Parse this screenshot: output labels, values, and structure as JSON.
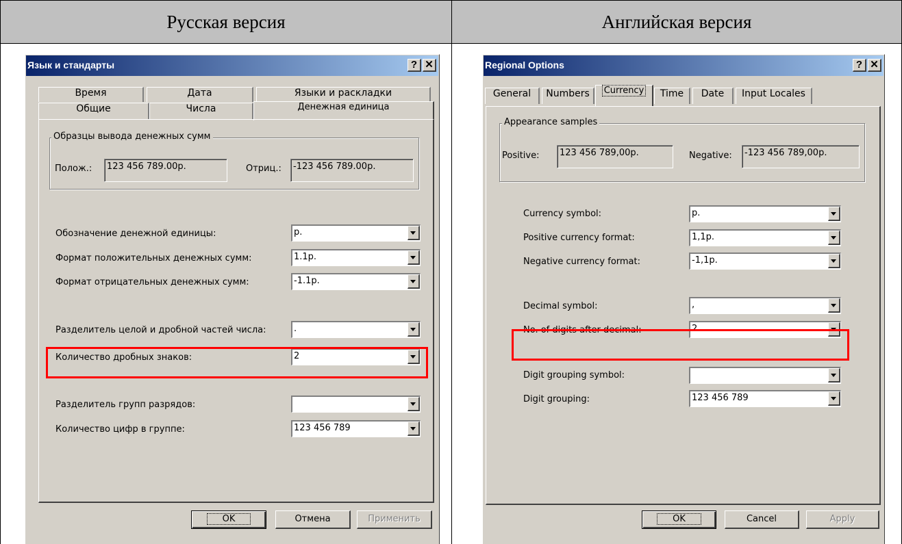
{
  "header": {
    "left": "Русская версия",
    "right": "Английская версия"
  },
  "ru": {
    "title": "Язык и стандарты",
    "help_btn": "?",
    "close_btn": "✕",
    "tabs": {
      "time": "Время",
      "date": "Дата",
      "langs": "Языки и раскладки",
      "general": "Общие",
      "numbers": "Числа",
      "currency": "Денежная единица"
    },
    "group_label": "Образцы вывода денежных сумм",
    "positive_label": "Полож.:",
    "positive_value": "123 456 789.00р.",
    "negative_label": "Отриц.:",
    "negative_value": "-123 456 789.00р.",
    "fields": [
      {
        "label": "Обозначение денежной единицы:",
        "value": "р."
      },
      {
        "label": "Формат положительных денежных сумм:",
        "value": "1.1р."
      },
      {
        "label": "Формат отрицательных денежных сумм:",
        "value": "-1.1р."
      },
      {
        "label": "Разделитель целой и дробной частей числа:",
        "value": "."
      },
      {
        "label": "Количество дробных знаков:",
        "value": "2"
      },
      {
        "label": "Разделитель групп разрядов:",
        "value": ""
      },
      {
        "label": "Количество цифр в группе:",
        "value": "123 456 789"
      }
    ],
    "ok": "OK",
    "cancel": "Отмена",
    "apply": "Применить"
  },
  "en": {
    "title": "Regional Options",
    "help_btn": "?",
    "close_btn": "✕",
    "tabs": {
      "general": "General",
      "numbers": "Numbers",
      "currency": "Currency",
      "time": "Time",
      "date": "Date",
      "locales": "Input Locales"
    },
    "group_label": "Appearance samples",
    "positive_label": "Positive:",
    "positive_value": "123 456 789,00р.",
    "negative_label": "Negative:",
    "negative_value": "-123 456 789,00р.",
    "fields": [
      {
        "label": "Currency symbol:",
        "value": "р."
      },
      {
        "label": "Positive currency format:",
        "value": "1,1р."
      },
      {
        "label": "Negative currency format:",
        "value": "-1,1р."
      },
      {
        "label": "Decimal symbol:",
        "value": ","
      },
      {
        "label": "No. of digits after decimal:",
        "value": "2"
      },
      {
        "label": "Digit grouping symbol:",
        "value": ""
      },
      {
        "label": "Digit grouping:",
        "value": "123 456 789"
      }
    ],
    "ok": "OK",
    "cancel": "Cancel",
    "apply": "Apply"
  },
  "colors": {
    "highlight": "#ff0000",
    "titlebar_start": "#0a246a",
    "titlebar_end": "#a6caf0",
    "face": "#d4d0c8"
  }
}
